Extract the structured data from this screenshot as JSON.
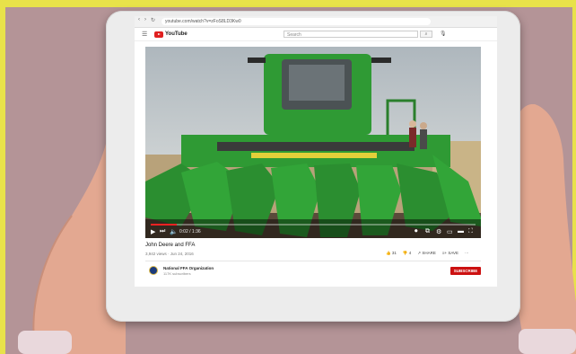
{
  "browser": {
    "url": "youtube.com/watch?v=zFoS8LD3Kw0",
    "nav": [
      "‹",
      "›",
      "↻"
    ]
  },
  "youtube": {
    "logo_text": "YouTube",
    "search_placeholder": "Search",
    "menu_icon": "hamburger-icon",
    "search_icon": "search-icon",
    "mic_icon": "mic-icon"
  },
  "video": {
    "time": "0:02 / 1:36",
    "progress": 0.08,
    "title": "John Deere and FFA",
    "meta": "3,942 views · Jun 24, 2016",
    "actions": {
      "like": "31",
      "dislike": "4",
      "share": "SHARE",
      "save": "SAVE",
      "more": "···"
    }
  },
  "channel": {
    "name": "National FFA Organization",
    "subs": "117K subscribers",
    "subscribe_label": "SUBSCRIBE"
  },
  "colors": {
    "background": "#b49497",
    "accent_yellow": "#e8e24a",
    "youtube_red": "#cc1111",
    "deere_green": "#2f9a34"
  }
}
